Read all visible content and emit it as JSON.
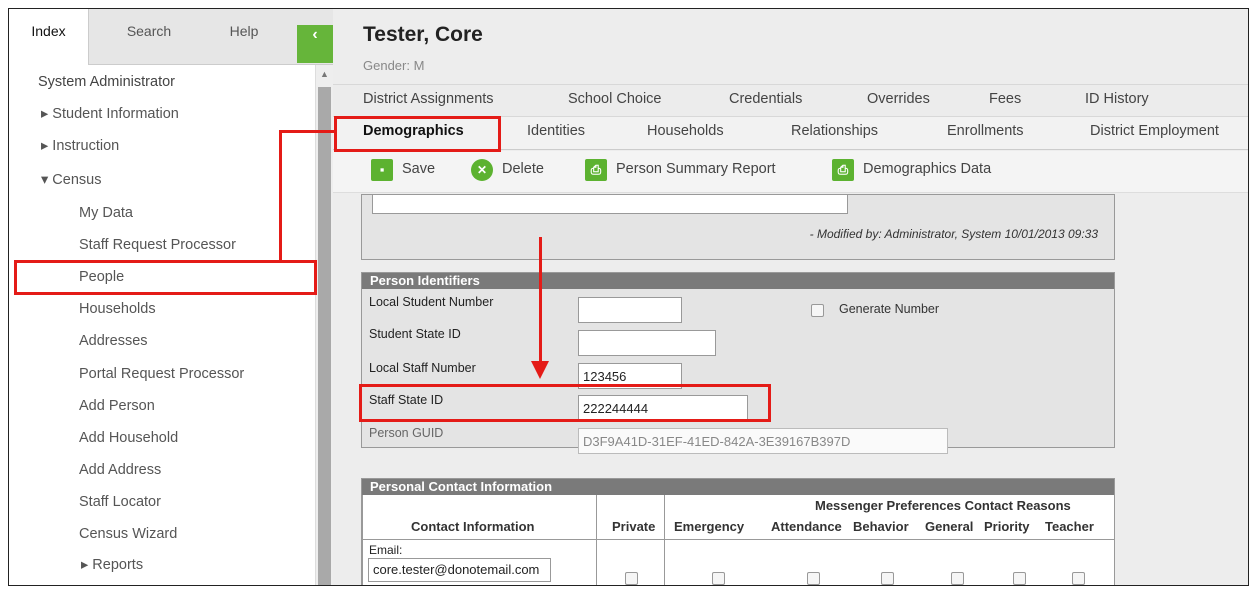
{
  "nav": {
    "tabs": [
      "Index",
      "Search",
      "Help"
    ],
    "collapse_glyph": "‹",
    "items": [
      {
        "label": "System Administrator"
      },
      {
        "label": "▸ Student Information"
      },
      {
        "label": "▸ Instruction"
      },
      {
        "label": "▾ Census"
      },
      {
        "label": "My Data"
      },
      {
        "label": "Staff Request Processor"
      },
      {
        "label": "People"
      },
      {
        "label": "Households"
      },
      {
        "label": "Addresses"
      },
      {
        "label": "Portal Request Processor"
      },
      {
        "label": "Add Person"
      },
      {
        "label": "Add Household"
      },
      {
        "label": "Add Address"
      },
      {
        "label": "Staff Locator"
      },
      {
        "label": "Census Wizard"
      },
      {
        "label": "▸ Reports"
      }
    ]
  },
  "header": {
    "name": "Tester, Core",
    "gender": "Gender: M"
  },
  "tabs_row1": [
    "District Assignments",
    "School Choice",
    "Credentials",
    "Overrides",
    "Fees",
    "ID History"
  ],
  "tabs_row2": [
    "Demographics",
    "Identities",
    "Households",
    "Relationships",
    "Enrollments",
    "District Employment"
  ],
  "active_tab": "Demographics",
  "toolbar": {
    "save": "Save",
    "delete": "Delete",
    "person_summary": "Person Summary Report",
    "demographics_data": "Demographics Data"
  },
  "comment": {
    "modified": "- Modified by: Administrator, System 10/01/2013 09:33"
  },
  "person_identifiers": {
    "title": "Person Identifiers",
    "local_student_number": {
      "label": "Local Student Number",
      "value": ""
    },
    "generate_number": "Generate Number",
    "student_state_id": {
      "label": "Student State ID",
      "value": ""
    },
    "local_staff_number": {
      "label": "Local Staff Number",
      "value": "123456"
    },
    "staff_state_id": {
      "label": "Staff State ID",
      "value": "222244444"
    },
    "person_guid": {
      "label": "Person GUID",
      "value": "D3F9A41D-31EF-41ED-842A-3E39167B397D"
    }
  },
  "contact": {
    "title": "Personal Contact Information",
    "col_contact_info": "Contact Information",
    "col_private": "Private",
    "messenger_header": "Messenger Preferences Contact Reasons",
    "reasons": [
      "Emergency",
      "Attendance",
      "Behavior",
      "General",
      "Priority",
      "Teacher"
    ],
    "email_label": "Email:",
    "email_value": "core.tester@donotemail.com"
  },
  "colors": {
    "accent_green": "#5cb230",
    "annotation_red": "#e41b17",
    "panel_header": "#7a7a7a"
  }
}
